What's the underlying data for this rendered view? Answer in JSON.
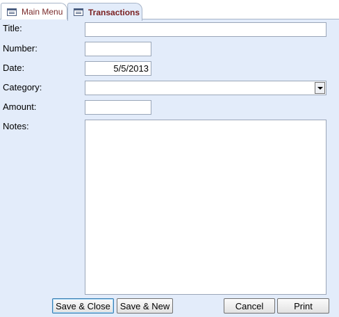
{
  "tabs": [
    {
      "label": "Main Menu"
    },
    {
      "label": "Transactions"
    }
  ],
  "form": {
    "title_label": "Title:",
    "title_value": "",
    "number_label": "Number:",
    "number_value": "",
    "date_label": "Date:",
    "date_value": "5/5/2013",
    "category_label": "Category:",
    "category_value": "",
    "amount_label": "Amount:",
    "amount_value": "",
    "notes_label": "Notes:",
    "notes_value": ""
  },
  "buttons": {
    "save_close": "Save & Close",
    "save_new": "Save & New",
    "cancel": "Cancel",
    "print": "Print"
  }
}
